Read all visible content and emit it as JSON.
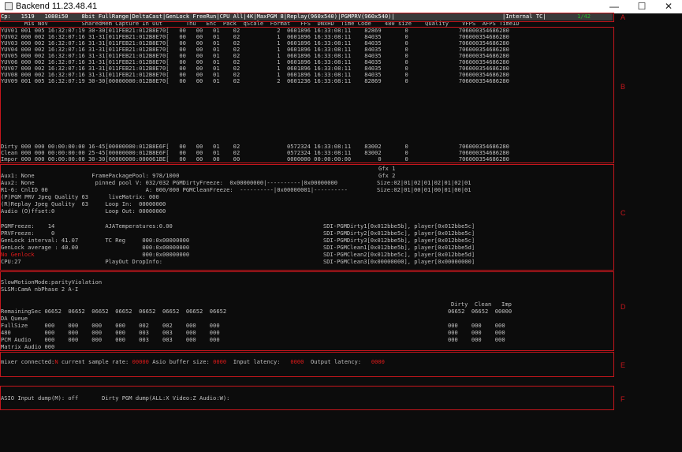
{
  "window": {
    "title": "Backend 11.23.48.41",
    "minimize": "—",
    "maximize": "☐",
    "close": "✕"
  },
  "status_bar": {
    "text": "Cp:   1519   1080i50    8bit FullRange|DeltaCast|GenLock FreeRun|CPU All|4K|MaxPGM 8|Replay(960x540)|PGMPRV(960x540)|",
    "internal_tc": "|Internal TC|",
    "frame": "1/42"
  },
  "section_b": {
    "header": "       Mis NoV          SharedMem Capture In Out       Thu   Enc  Pack  qScale  Format   FFS  DNxHD  Time Code    480 size    Quality    VFPS  AFPS TimeID",
    "rows": [
      "YUV01 001 005 16:32:07:19 30-30[011FEB21:012B8E70[   00   00   01    02           2  0601896 16:33:08:11    82869       0               706000354686280",
      "YUV02 000 002 16:32:07:16 31-31[011FEB21:012B8E70[   00   00   01    02           1  0601896 16:33:08:11    84035       0               706000354686280",
      "YUV03 000 002 16:32:07:16 31-31[011FEB21:012B8E70[   00   00   01    02           1  0601896 16:33:08:11    84035       0               706000354686280",
      "YUV04 000 002 16:32:07:16 31-31[011FEB21:012B8E70[   00   00   01    02           1  0601896 16:33:08:11    84035       0               706000354686280",
      "YUV05 000 002 16:32:07:16 31-31[011FEB21:012B8E70[   00   00   01    02           1  0601896 16:33:08:11    84035       0               706000354686280",
      "YUV06 000 002 16:32:07:16 31-31[011FEB21:012B8E70[   00   00   01    02           1  0601896 16:33:08:11    84035       0               706000354686280",
      "YUV07 000 002 16:32:07:16 31-31[011FEB21:012B8E70[   00   00   01    02           1  0601896 16:33:08:11    84035       0               706000354686280",
      "YUV08 000 002 16:32:07:16 31-31[011FEB21:012B8E70[   00   00   01    02           1  0601896 16:33:08:11    84035       0               706000354686280",
      "YUV09 001 005 16:32:07:19 30-30[00000000:012B8E70[   00   00   01    02           2  0601236 16:33:08:11    82869       0               706000354686280"
    ],
    "summary": [
      "Dirty 000 000 00:00:00:00 16-45[00000000:012B8E6F[   00   00   01    02              0572324 16:33:08:11    83002       0               706000354686280",
      "Clean 000 000 00:00:00:00 25-45[00000000:012B8E6F[   00   00   01    02              0572324 16:33:08:11    83002       0               706000354686280",
      "Impor 000 000 00:00:00:00 30-30[00000000:000061BE[   00   00   00    00              0000000 00:00:00:00        0       0               706000354686280"
    ]
  },
  "section_c": {
    "gfx1": "Gfx 1",
    "gfx2": "Gfx 2",
    "lines": [
      "Aux1: None                 FramePackagePool: 978/1000",
      "Aux2: None                  pinned pool V: 032/032 PGMDirtyFreeze:  0x00000000|----------|0x00000000",
      "R1-6: CnlID 00                             A: 000/000 PGMCleanFreeze:  ----------|0x00000001|----------",
      "(P)PGM PRV Jpeg Quality 63      liveMatrix: 000",
      "(R)Replay Jpeg Quality  63     Loop In:  00000000",
      "Audio (O)ffset:0               Loop Out: 00000000"
    ],
    "sizes": [
      "Size:02|01|02|01|02|01|02|01",
      "Size:02|01|00|01|00|01|00|01"
    ],
    "lower_left": [
      "PGMFreeze:    14               AJATemperatures:0.00",
      "PRVFreeze:     0",
      "GenLock interval: 41.07        TC Reg     000:0x00000000",
      "GenLock average : 40.00                   000:0x00000000",
      "                                          000:0x00000000",
      "CPU:27                         PlayOut DropInfo:"
    ],
    "no_genlock": "No Genlock",
    "sdi": [
      "SDI-PGMDirty1[0x012bbe5b], player[0x012bbe5c]",
      "SDI-PGMDirty2[0x012bbe5c], player[0x012bbe5c]",
      "SDI-PGMDirty3[0x012bbe5b], player[0x012bbe5c]",
      "SDI-PGMClean1[0x012bbe5b], player[0x012bbe5d]",
      "SDI-PGMClean2[0x012bbe5c], player[0x012bbe5d]",
      "SDI-PGMClean3[0x00000000], player[0x00000000]"
    ]
  },
  "section_d": {
    "mode": "SlowMotionMode:parityViolation",
    "slsm": "SLSM:CamA nbPhase 2 A-I",
    "dci_header": "Dirty  Clean   Imp",
    "rows": [
      "RemainingSec 06652  06652  06652  06652  06652  06652  06652  06652",
      "DA Queue",
      "FullSize     000    000    000    000    002    002    000    000",
      "480          000    000    000    000    003    003    000    000",
      "PCM Audio    000    000    000    000    003    003    000    000",
      "Matrix Audio 000"
    ],
    "right_rows": [
      "06652  06652  00000",
      "",
      "000    000    000",
      "000    000    000",
      "000    000    000",
      ""
    ]
  },
  "section_e": {
    "prefix": "mixer connected:",
    "n": "N",
    "sample_label": " current sample rate: ",
    "sample_value": "00000",
    "asio_label": " Asio buffer size: ",
    "asio_value": "0000",
    "in_label": "  Input latency:   ",
    "in_value": "0000",
    "out_label": "  Output latency:   ",
    "out_value": "0000"
  },
  "section_f": {
    "text": "ASIO Input dump(M): off       Dirty PGM dump(ALL:X Video:Z Audio:W):"
  },
  "labels": {
    "a": "A",
    "b": "B",
    "c": "C",
    "d": "D",
    "e": "E",
    "f": "F"
  },
  "colors": {
    "annotation_red": "#c4161c",
    "console_bg": "#0c0c0c",
    "console_text": "#c0c0c0",
    "alert_text": "#e11a1a",
    "frame_counter": "#2bb52b"
  }
}
